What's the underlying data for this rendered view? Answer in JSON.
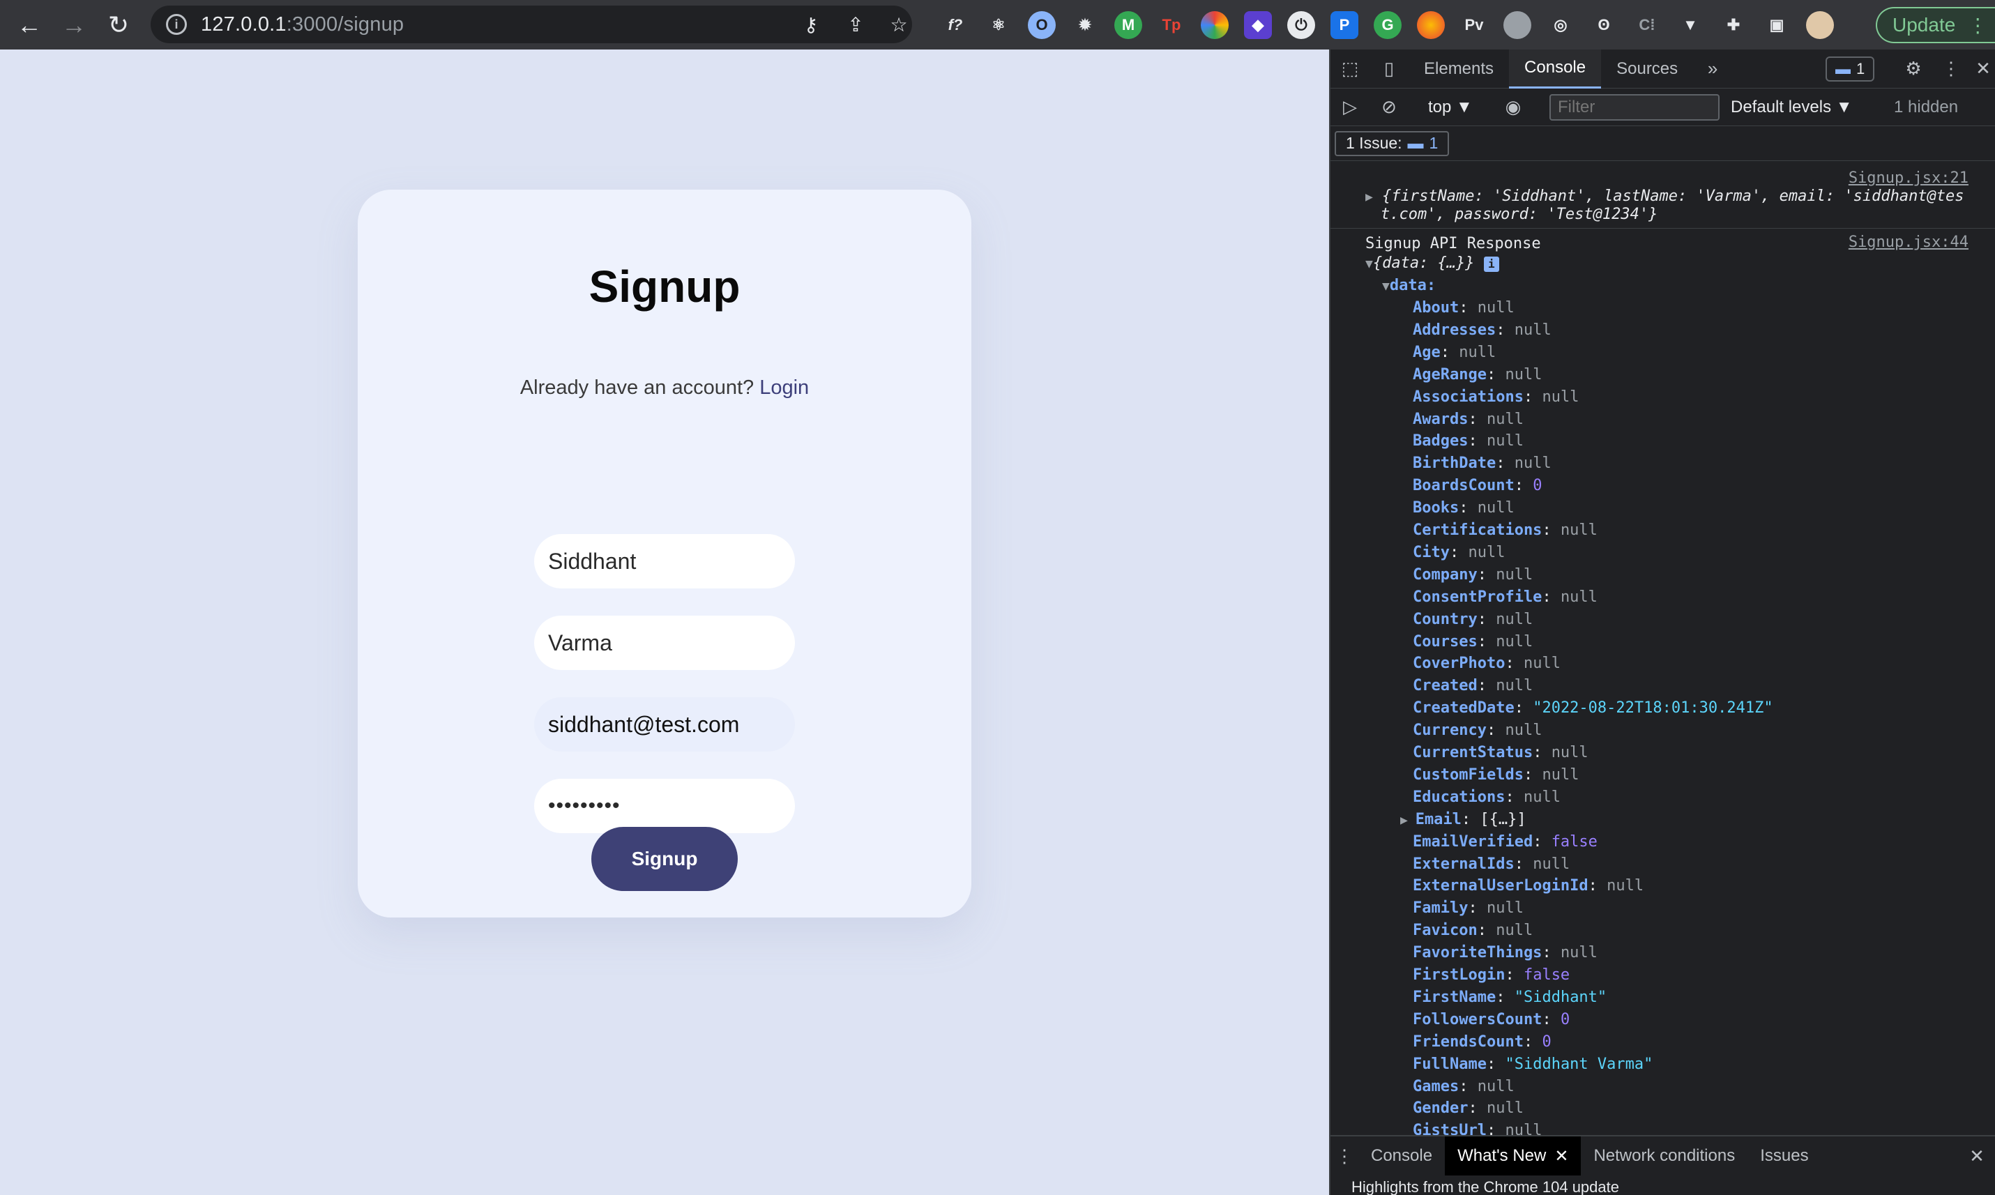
{
  "browser": {
    "url_host": "127.0.0.1",
    "url_rest": ":3000/signup",
    "update_label": "Update",
    "extensions": [
      "f?",
      "react",
      "O",
      "gear",
      "M",
      "Tp",
      "color",
      "box",
      "power",
      "P",
      "G",
      "C",
      "Pv",
      "pin",
      "aperture",
      "owl",
      "C|",
      "V",
      "puzzle",
      "sidebar",
      "avatar"
    ]
  },
  "page": {
    "title": "Signup",
    "account_prompt": "Already have an account?",
    "login_link": "Login",
    "first_name": "Siddhant",
    "last_name": "Varma",
    "email": "siddhant@test.com",
    "password": "•••••••••",
    "submit_label": "Signup"
  },
  "devtools": {
    "tabs": [
      "Elements",
      "Console",
      "Sources"
    ],
    "issue_badge_count": "1",
    "context": "top ▼",
    "filter_placeholder": "Filter",
    "levels": "Default levels ▼",
    "hidden": "1 hidden",
    "issues_label": "1 Issue:",
    "issues_count": "1",
    "log1_src": "Signup.jsx:21",
    "log1_line1": "{firstName: 'Siddhant', lastName: 'Varma', email: 'siddhant@tes",
    "log1_line2": "t.com', password: 'Test@1234'}",
    "log2_src": "Signup.jsx:44",
    "log2_label": "Signup API Response",
    "log2_summary": "{data: {…}}",
    "data_key": "data:",
    "props": [
      {
        "k": "About",
        "v": "null",
        "t": "null"
      },
      {
        "k": "Addresses",
        "v": "null",
        "t": "null"
      },
      {
        "k": "Age",
        "v": "null",
        "t": "null"
      },
      {
        "k": "AgeRange",
        "v": "null",
        "t": "null"
      },
      {
        "k": "Associations",
        "v": "null",
        "t": "null"
      },
      {
        "k": "Awards",
        "v": "null",
        "t": "null"
      },
      {
        "k": "Badges",
        "v": "null",
        "t": "null"
      },
      {
        "k": "BirthDate",
        "v": "null",
        "t": "null"
      },
      {
        "k": "BoardsCount",
        "v": "0",
        "t": "num"
      },
      {
        "k": "Books",
        "v": "null",
        "t": "null"
      },
      {
        "k": "Certifications",
        "v": "null",
        "t": "null"
      },
      {
        "k": "City",
        "v": "null",
        "t": "null"
      },
      {
        "k": "Company",
        "v": "null",
        "t": "null"
      },
      {
        "k": "ConsentProfile",
        "v": "null",
        "t": "null"
      },
      {
        "k": "Country",
        "v": "null",
        "t": "null"
      },
      {
        "k": "Courses",
        "v": "null",
        "t": "null"
      },
      {
        "k": "CoverPhoto",
        "v": "null",
        "t": "null"
      },
      {
        "k": "Created",
        "v": "null",
        "t": "null"
      },
      {
        "k": "CreatedDate",
        "v": "\"2022-08-22T18:01:30.241Z\"",
        "t": "sval"
      },
      {
        "k": "Currency",
        "v": "null",
        "t": "null"
      },
      {
        "k": "CurrentStatus",
        "v": "null",
        "t": "null"
      },
      {
        "k": "CustomFields",
        "v": "null",
        "t": "null"
      },
      {
        "k": "Educations",
        "v": "null",
        "t": "null"
      },
      {
        "k": "Email",
        "v": "[{…}]",
        "t": "arr"
      },
      {
        "k": "EmailVerified",
        "v": "false",
        "t": "bool"
      },
      {
        "k": "ExternalIds",
        "v": "null",
        "t": "null"
      },
      {
        "k": "ExternalUserLoginId",
        "v": "null",
        "t": "null"
      },
      {
        "k": "Family",
        "v": "null",
        "t": "null"
      },
      {
        "k": "Favicon",
        "v": "null",
        "t": "null"
      },
      {
        "k": "FavoriteThings",
        "v": "null",
        "t": "null"
      },
      {
        "k": "FirstLogin",
        "v": "false",
        "t": "bool"
      },
      {
        "k": "FirstName",
        "v": "\"Siddhant\"",
        "t": "sval"
      },
      {
        "k": "FollowersCount",
        "v": "0",
        "t": "num"
      },
      {
        "k": "FriendsCount",
        "v": "0",
        "t": "num"
      },
      {
        "k": "FullName",
        "v": "\"Siddhant Varma\"",
        "t": "sval"
      },
      {
        "k": "Games",
        "v": "null",
        "t": "null"
      },
      {
        "k": "Gender",
        "v": "null",
        "t": "null"
      },
      {
        "k": "GistsUrl",
        "v": "null",
        "t": "null"
      }
    ],
    "drawer_tabs": [
      "Console",
      "What's New",
      "Network conditions",
      "Issues"
    ],
    "drawer_text": "Highlights from the Chrome 104 update"
  }
}
